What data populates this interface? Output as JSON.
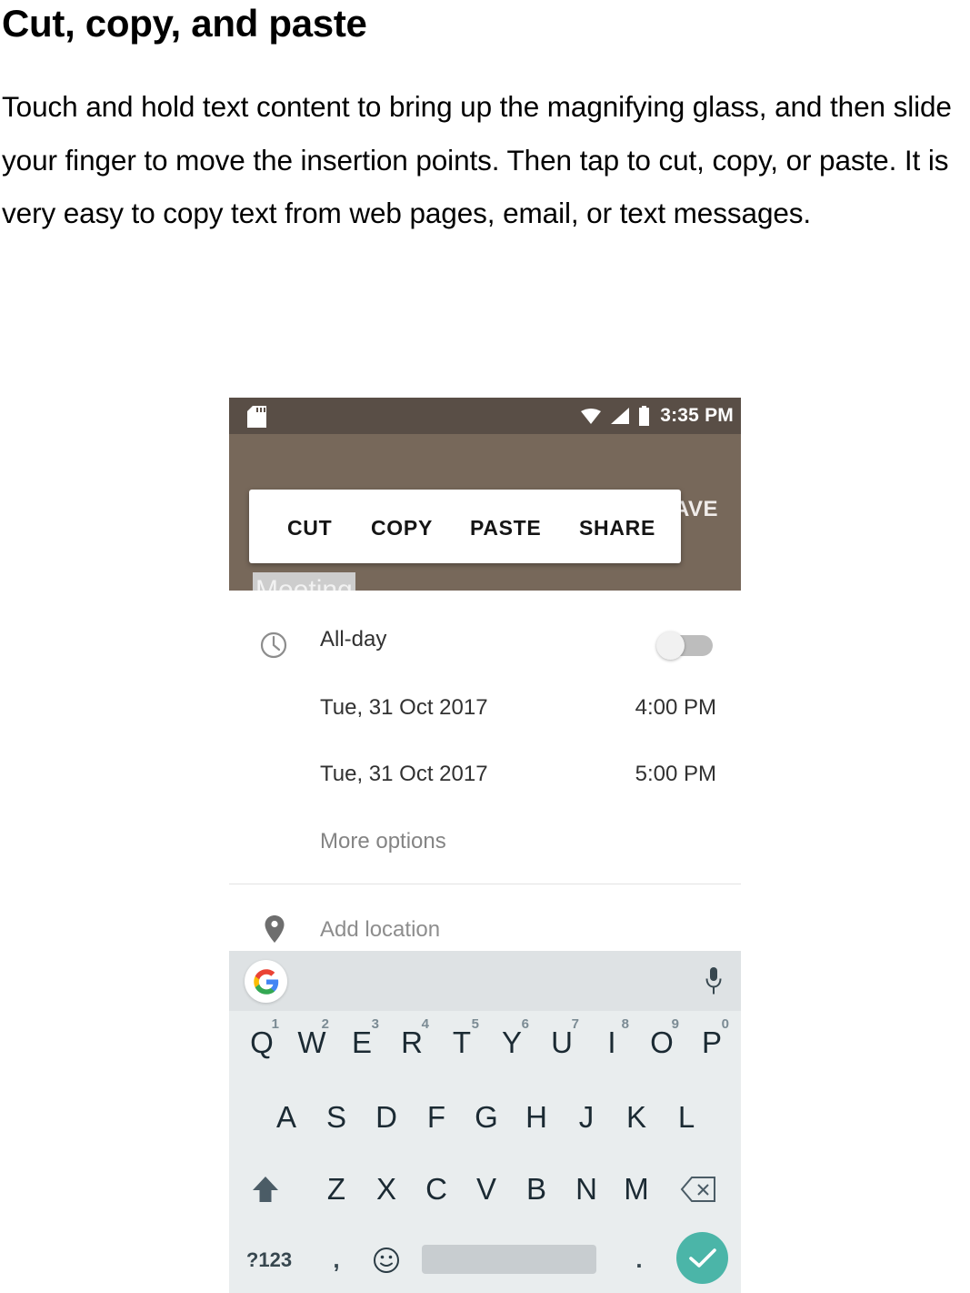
{
  "document": {
    "title": "Cut, copy, and paste",
    "body": "Touch and hold text content to bring up the magnifying glass, and then slide your finger to move the insertion points. Then tap to cut, copy, or paste. It is very easy to copy text from web pages, email, or text messages."
  },
  "phone": {
    "status_bar": {
      "time": "3:35 PM",
      "icons": [
        "sd-card-icon",
        "wifi-icon",
        "signal-icon",
        "battery-icon"
      ]
    },
    "app_bar": {
      "save_label": "AVE"
    },
    "context_menu": {
      "items": [
        {
          "label": "CUT"
        },
        {
          "label": "COPY"
        },
        {
          "label": "PASTE"
        },
        {
          "label": "SHARE"
        }
      ]
    },
    "selection": {
      "selected_text": "Meeting"
    },
    "form": {
      "all_day": {
        "label": "All-day",
        "toggle_state": "off",
        "icon": "clock-icon"
      },
      "start": {
        "date": "Tue, 31 Oct 2017",
        "time": "4:00 PM"
      },
      "end": {
        "date": "Tue, 31 Oct 2017",
        "time": "5:00 PM"
      },
      "more_options_label": "More options",
      "location": {
        "placeholder": "Add location",
        "icon": "location-pin-icon"
      }
    },
    "keyboard": {
      "toolbar": {
        "left_icon": "google-logo-icon",
        "right_icon": "microphone-icon"
      },
      "row1": [
        {
          "letter": "Q",
          "num": "1"
        },
        {
          "letter": "W",
          "num": "2"
        },
        {
          "letter": "E",
          "num": "3"
        },
        {
          "letter": "R",
          "num": "4"
        },
        {
          "letter": "T",
          "num": "5"
        },
        {
          "letter": "Y",
          "num": "6"
        },
        {
          "letter": "U",
          "num": "7"
        },
        {
          "letter": "I",
          "num": "8"
        },
        {
          "letter": "O",
          "num": "9"
        },
        {
          "letter": "P",
          "num": "0"
        }
      ],
      "row2": [
        {
          "letter": "A"
        },
        {
          "letter": "S"
        },
        {
          "letter": "D"
        },
        {
          "letter": "F"
        },
        {
          "letter": "G"
        },
        {
          "letter": "H"
        },
        {
          "letter": "J"
        },
        {
          "letter": "K"
        },
        {
          "letter": "L"
        }
      ],
      "row3": [
        {
          "letter": "Z"
        },
        {
          "letter": "X"
        },
        {
          "letter": "C"
        },
        {
          "letter": "V"
        },
        {
          "letter": "B"
        },
        {
          "letter": "N"
        },
        {
          "letter": "M"
        }
      ],
      "row3_shift_icon": "shift-icon",
      "row3_delete_icon": "backspace-icon",
      "row4": {
        "symbols_label": "?123",
        "comma_label": ",",
        "emoji_icon": "emoji-smiley-icon",
        "space_label": "",
        "period_label": ".",
        "enter_icon": "checkmark-icon"
      }
    }
  },
  "colors": {
    "status_bar": "#594e46",
    "app_dim": "#77685a",
    "selection_handle": "#4285f4",
    "selection_highlight": "#cdcdcd",
    "keyboard_bg": "#e9edee",
    "keyboard_toolbar": "#dee2e4",
    "enter_key": "#4bb5a8",
    "spacebar": "#c8cdd0"
  }
}
